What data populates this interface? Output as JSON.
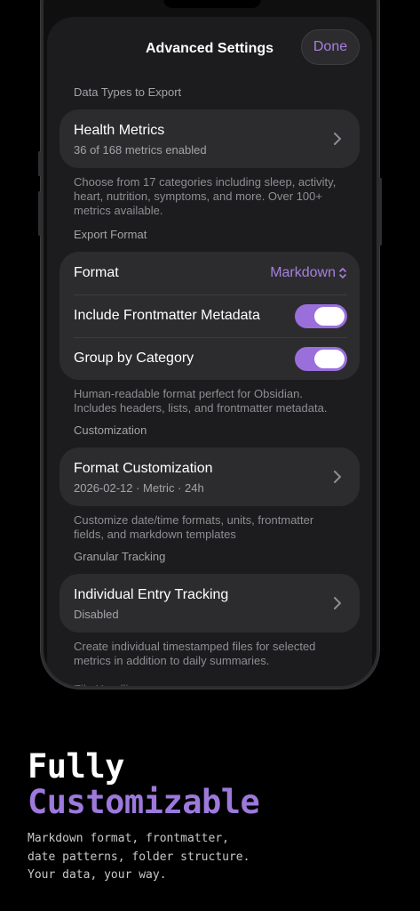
{
  "sheet": {
    "title": "Advanced Settings",
    "done_label": "Done"
  },
  "sections": {
    "data_types": {
      "header": "Data Types to Export",
      "row_title": "Health Metrics",
      "row_subtitle": "36 of 168 metrics enabled",
      "footer": "Choose from 17 categories including sleep, activity, heart, nutrition, symptoms, and more. Over 100+ metrics available."
    },
    "export_format": {
      "header": "Export Format",
      "format_label": "Format",
      "format_value": "Markdown",
      "frontmatter_label": "Include Frontmatter Metadata",
      "frontmatter_on": true,
      "group_label": "Group by Category",
      "group_on": true,
      "footer": "Human-readable format perfect for Obsidian. Includes headers, lists, and frontmatter metadata."
    },
    "customization": {
      "header": "Customization",
      "row_title": "Format Customization",
      "row_subtitle": "2026-02-12 · Metric · 24h",
      "footer": "Customize date/time formats, units, frontmatter fields, and markdown templates"
    },
    "granular": {
      "header": "Granular Tracking",
      "row_title": "Individual Entry Tracking",
      "row_subtitle": "Disabled",
      "footer": "Create individual timestamped files for selected metrics in addition to daily summaries."
    },
    "file_handling": {
      "header": "File Handling"
    }
  },
  "promo": {
    "line1": "Fully",
    "line2": "Customizable",
    "description": "Markdown format, frontmatter,\ndate patterns, folder structure.\nYour data, your way."
  },
  "colors": {
    "accent": "#a77fe0",
    "toggle_on": "#9a6fdb",
    "promo_accent": "#9d79dc"
  },
  "icons": [
    "chevron-right-icon",
    "chevron-up-down-icon"
  ]
}
